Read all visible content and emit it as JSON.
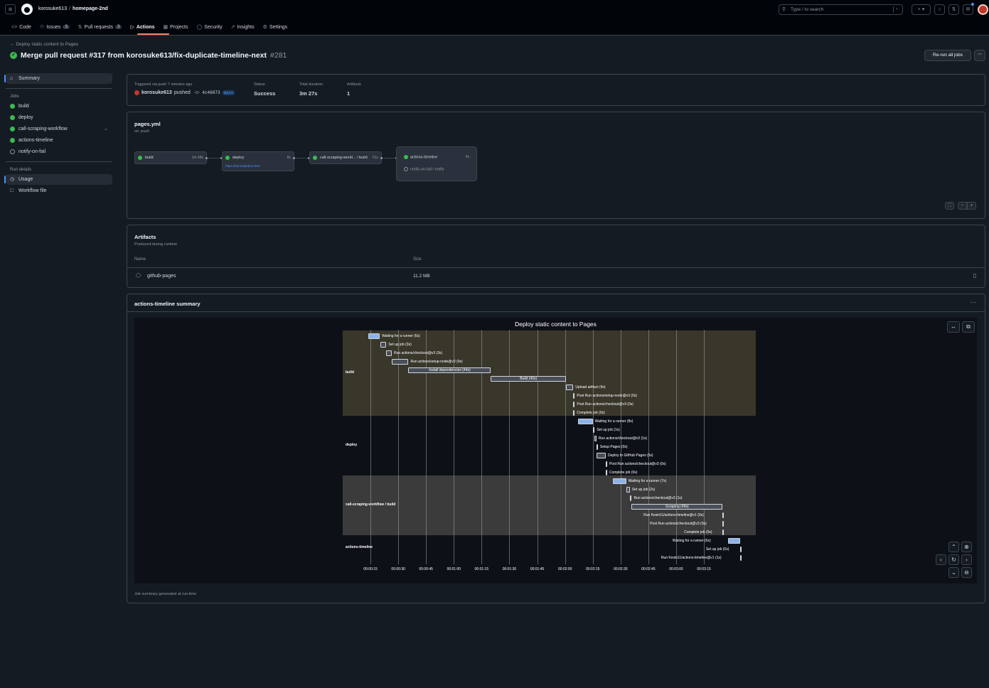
{
  "header": {
    "owner": "korosuke613",
    "separator": "/",
    "repo": "homepage-2nd",
    "search_placeholder": "Type / to search"
  },
  "tabs": [
    {
      "label": "Code",
      "count": ""
    },
    {
      "label": "Issues",
      "count": "3"
    },
    {
      "label": "Pull requests",
      "count": "3"
    },
    {
      "label": "Actions",
      "count": ""
    },
    {
      "label": "Projects",
      "count": ""
    },
    {
      "label": "Security",
      "count": ""
    },
    {
      "label": "Insights",
      "count": ""
    },
    {
      "label": "Settings",
      "count": ""
    }
  ],
  "run": {
    "back_link": "Deploy static content to Pages",
    "title": "Merge pull request #317 from korosuke613/fix-duplicate-timeline-next",
    "number": "#281",
    "rerun_label": "Re-run all jobs"
  },
  "sidebar": {
    "summary": "Summary",
    "jobs_heading": "Jobs",
    "jobs": [
      "build",
      "deploy",
      "call-scraping-workflow",
      "actions-timeline",
      "notify-on-fail"
    ],
    "run_details_heading": "Run details",
    "usage": "Usage",
    "workflow_file": "Workflow file"
  },
  "summary": {
    "triggered_label": "Triggered via push 7 minutes ago",
    "actor": "korosuke613",
    "pushed": "pushed",
    "commit": "4c46873",
    "branch": "main",
    "status_label": "Status",
    "status_value": "Success",
    "duration_label": "Total duration",
    "duration_value": "3m 27s",
    "artifacts_label": "Artifacts",
    "artifacts_value": "1"
  },
  "workflow": {
    "file": "pages.yml",
    "trigger": "on: push",
    "jobs": [
      {
        "name": "build",
        "time": "1m 48s"
      },
      {
        "name": "deploy",
        "time": "8s",
        "link": "https://korosuke613.dev/"
      },
      {
        "name": "call-scraping-workf... / build",
        "time": "51s"
      },
      {
        "name": "actions-timeline",
        "time": "4s"
      },
      {
        "name": "notify-on-fail / notify",
        "time": ""
      }
    ]
  },
  "artifacts": {
    "title": "Artifacts",
    "subtitle": "Produced during runtime",
    "col_name": "Name",
    "col_size": "Size",
    "rows": [
      {
        "name": "github-pages",
        "size": "11.2 MB"
      }
    ]
  },
  "job_summary": {
    "title": "actions-timeline summary",
    "footer": "Job summary generated at run-time"
  },
  "chart_data": {
    "type": "gantt",
    "title": "Deploy static content to Pages",
    "x_ticks": [
      "00:00:15",
      "00:00:30",
      "00:00:45",
      "00:01:00",
      "00:01:15",
      "00:01:30",
      "00:01:45",
      "00:02:00",
      "00:02:15",
      "00:02:30",
      "00:02:45",
      "00:03:00",
      "00:03:15"
    ],
    "x_range_seconds": [
      0,
      223
    ],
    "sections": [
      {
        "name": "build",
        "color": "#39362a"
      },
      {
        "name": "deploy",
        "color": "#0d1117"
      },
      {
        "name": "call-scraping-workflow / build",
        "color": "#3b3b3b"
      },
      {
        "name": "actions-timeline",
        "color": "#0d1117"
      }
    ],
    "tasks": [
      {
        "section": 0,
        "label": "Waiting for a runner (6s)",
        "start": 14,
        "end": 20,
        "kind": "wait",
        "inside": false
      },
      {
        "section": 0,
        "label": "Set up job (3s)",
        "start": 20.5,
        "end": 23.5,
        "kind": "step",
        "inside": false
      },
      {
        "section": 0,
        "label": "Run actions/checkout@v3 (3s)",
        "start": 23.5,
        "end": 26.5,
        "kind": "step",
        "inside": false
      },
      {
        "section": 0,
        "label": "Run actions/setup-node@v3 (9s)",
        "start": 26.5,
        "end": 35.5,
        "kind": "step",
        "inside": false
      },
      {
        "section": 0,
        "label": "Install dependencies (44s)",
        "start": 35.5,
        "end": 80,
        "kind": "step",
        "inside": true
      },
      {
        "section": 0,
        "label": "Build (40s)",
        "start": 80,
        "end": 120.5,
        "kind": "step",
        "inside": true
      },
      {
        "section": 0,
        "label": "Upload artifact (4s)",
        "start": 120.5,
        "end": 124.5,
        "kind": "step",
        "inside": false
      },
      {
        "section": 0,
        "label": "Post Run actions/setup-node@v3 (0s)",
        "start": 124.5,
        "end": 124.5,
        "kind": "step",
        "inside": false
      },
      {
        "section": 0,
        "label": "Post Run actions/checkout@v3 (0s)",
        "start": 124.5,
        "end": 124.5,
        "kind": "step",
        "inside": false
      },
      {
        "section": 0,
        "label": "Complete job (0s)",
        "start": 124.5,
        "end": 124.5,
        "kind": "step",
        "inside": false
      },
      {
        "section": 1,
        "label": "Waiting for a runner (8s)",
        "start": 127,
        "end": 135,
        "kind": "wait",
        "inside": false
      },
      {
        "section": 1,
        "label": "Set up job (1s)",
        "start": 135,
        "end": 136,
        "kind": "step",
        "inside": false
      },
      {
        "section": 1,
        "label": "Run actions/checkout@v3 (1s)",
        "start": 136,
        "end": 137,
        "kind": "step",
        "inside": false
      },
      {
        "section": 1,
        "label": "Setup Pages (0s)",
        "start": 137,
        "end": 137,
        "kind": "step",
        "inside": false
      },
      {
        "section": 1,
        "label": "Deploy to GitHub Pages (5s)",
        "start": 137,
        "end": 142,
        "kind": "step",
        "inside": false
      },
      {
        "section": 1,
        "label": "Post Run actions/checkout@v3 (0s)",
        "start": 142,
        "end": 142,
        "kind": "step",
        "inside": false
      },
      {
        "section": 1,
        "label": "Complete job (0s)",
        "start": 142,
        "end": 142,
        "kind": "step",
        "inside": false
      },
      {
        "section": 2,
        "label": "Waiting for a runner (7s)",
        "start": 146,
        "end": 153,
        "kind": "wait",
        "inside": false
      },
      {
        "section": 2,
        "label": "Set up job (2s)",
        "start": 153,
        "end": 155,
        "kind": "step",
        "inside": false
      },
      {
        "section": 2,
        "label": "Run actions/checkout@v3 (1s)",
        "start": 155,
        "end": 156,
        "kind": "step",
        "inside": false
      },
      {
        "section": 2,
        "label": "Scraping (49s)",
        "start": 156,
        "end": 205,
        "kind": "step",
        "inside": true
      },
      {
        "section": 2,
        "label": "Run Kesin11/actions-timeline@v1 (0s)",
        "start": 205,
        "end": 205,
        "kind": "step",
        "inside": false
      },
      {
        "section": 2,
        "label": "Post Run actions/checkout@v3 (0s)",
        "start": 205,
        "end": 205,
        "kind": "step",
        "inside": false
      },
      {
        "section": 2,
        "label": "Complete job (0s)",
        "start": 205,
        "end": 205,
        "kind": "step",
        "inside": false
      },
      {
        "section": 3,
        "label": "Waiting for a runner (6s)",
        "start": 208,
        "end": 214.5,
        "kind": "wait",
        "inside": false
      },
      {
        "section": 3,
        "label": "Set up job (0s)",
        "start": 214.5,
        "end": 214.5,
        "kind": "step",
        "inside": false
      },
      {
        "section": 3,
        "label": "Run Kesin11/actions-timeline@v1 (1s)",
        "start": 214.5,
        "end": 215.5,
        "kind": "step",
        "inside": false
      }
    ]
  }
}
